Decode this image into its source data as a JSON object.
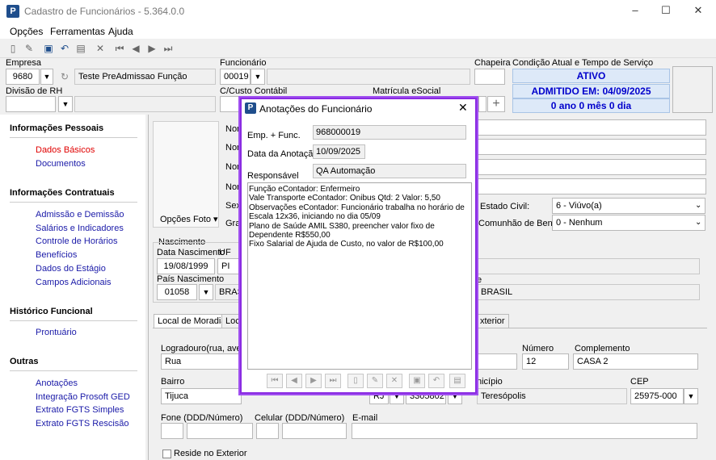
{
  "window": {
    "title": "Cadastro de Funcionários - 5.364.0.0",
    "minimize": "–",
    "maximize": "☐",
    "close": "✕"
  },
  "menu": [
    "Opções",
    "Ferramentas",
    "Ajuda"
  ],
  "toolbar_icons": [
    "new-doc-icon",
    "edit-icon",
    "save-icon",
    "undo-icon",
    "print-icon",
    "delete-icon",
    "first-icon",
    "prev-icon",
    "next-icon",
    "last-icon"
  ],
  "header": {
    "empresa_label": "Empresa",
    "empresa_code": "9680",
    "empresa_name": "Teste PreAdmissao Função",
    "funcionario_label": "Funcionário",
    "funcionario_code": "00019",
    "chapeira_label": "Chapeira",
    "condicao_label": "Condição Atual e Tempo de Serviço",
    "status": "ATIVO",
    "admitido": "ADMITIDO EM: 04/09/2025",
    "tempo": "0 ano 0 mês 0 dia",
    "divisao_label": "Divisão de RH",
    "ccusto_label": "C/Custo Contábil",
    "matricula_label": "Matrícula eSocial"
  },
  "sidebar": {
    "sections": [
      {
        "title": "Informações Pessoais",
        "items": [
          "Dados Básicos",
          "Documentos"
        ]
      },
      {
        "title": "Informações Contratuais",
        "items": [
          "Admissão e Demissão",
          "Salários e Indicadores",
          "Controle de Horários",
          "Benefícios",
          "Dados do Estágio",
          "Campos Adicionais"
        ]
      },
      {
        "title": "Histórico Funcional",
        "items": [
          "Prontuário"
        ]
      },
      {
        "title": "Outras",
        "items": [
          "Anotações",
          "Integração Prosoft GED",
          "Extrato FGTS Simples",
          "Extrato FGTS Rescisão"
        ]
      }
    ],
    "active_item": "Dados Básicos"
  },
  "form": {
    "opcoes_foto": "Opções Foto",
    "nom_labels": [
      "Nom",
      "Nom",
      "Nom",
      "Nom"
    ],
    "sexo_label": "Sexo",
    "grau_label": "Grau",
    "estado_civil_label": "Estado Civil:",
    "estado_civil": "6 - Viúvo(a)",
    "comunhao_label": "Comunhão de Bens:",
    "comunhao": "0 - Nenhum",
    "nascimento_label": "Nascimento",
    "data_nasc_label": "Data Nascimento",
    "data_nasc": "19/08/1999",
    "uf_label": "UF",
    "uf": "PI",
    "pais_nasc_label": "País Nascimento",
    "pais_code": "01058",
    "pais_name": "BRASI",
    "pais_right_label": "e",
    "pais_right": "BRASIL",
    "tab_moradia": "Local de Moradia",
    "tab_2": "Loca",
    "tab_exterior": "xterior",
    "logradouro_label": "Logradouro(rua, avenic",
    "logradouro": "Rua",
    "numero_label": "Número",
    "numero": "12",
    "complemento_label": "Complemento",
    "complemento": "CASA 2",
    "bairro_label": "Bairro",
    "bairro": "Tijuca",
    "uf2": "RJ",
    "municipio_code": "3305802",
    "municipio_label": "nicípio",
    "municipio": "Teresópolis",
    "cep_label": "CEP",
    "cep": "25975-000",
    "fone_label": "Fone (DDD/Número)",
    "celular_label": "Celular (DDD/Número)",
    "email_label": "E-mail",
    "reside_exterior": "Reside no Exterior"
  },
  "dialog": {
    "title": "Anotações do Funcionário",
    "emp_label": "Emp. + Func.",
    "emp_value": "968000019",
    "data_label": "Data da Anotação",
    "data_value": "10/09/2025",
    "resp_label": "Responsável",
    "resp_value": "QA Automação",
    "memo_lines": [
      "Função eContador: Enfermeiro",
      "Vale Transporte eContador: Onibus Qtd: 2 Valor: 5,50",
      "Observações eContador: Funcionário trabalha no horário de",
      "Escala 12x36, iniciando no dia 05/09",
      "Plano de Saúde AMIL S380, preencher valor fixo de",
      "Dependente R$550,00",
      "Fixo Salarial de Ajuda de Custo, no valor de R$100,00"
    ]
  }
}
